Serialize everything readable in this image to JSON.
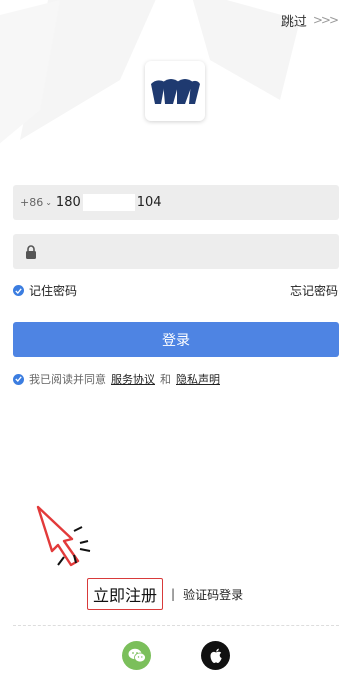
{
  "header": {
    "skip_label": "跳过",
    "skip_chevrons": ">>>"
  },
  "brand": {
    "logo_icon": "bank-logo-icon",
    "logo_color": "#1f3a70"
  },
  "phone": {
    "country_code": "+86",
    "number_prefix": "180",
    "number_suffix": "104"
  },
  "password": {
    "value": "",
    "icon": "lock-icon"
  },
  "options": {
    "remember_label": "记住密码",
    "remember_checked": true,
    "forgot_label": "忘记密码"
  },
  "login": {
    "button_label": "登录",
    "button_color": "#4e84e3"
  },
  "agreement": {
    "checked": true,
    "prefix": "我已阅读并同意",
    "service_link": "服务协议",
    "and_text": "和",
    "privacy_link": "隐私声明"
  },
  "footer": {
    "register_label": "立即注册",
    "separator": "|",
    "sms_login_label": "验证码登录",
    "social": [
      {
        "name": "wechat-icon",
        "color": "#7bbf5b"
      },
      {
        "name": "apple-icon",
        "color": "#111111"
      }
    ]
  },
  "colors": {
    "accent": "#3b7de0",
    "highlight": "#d83a3a"
  }
}
